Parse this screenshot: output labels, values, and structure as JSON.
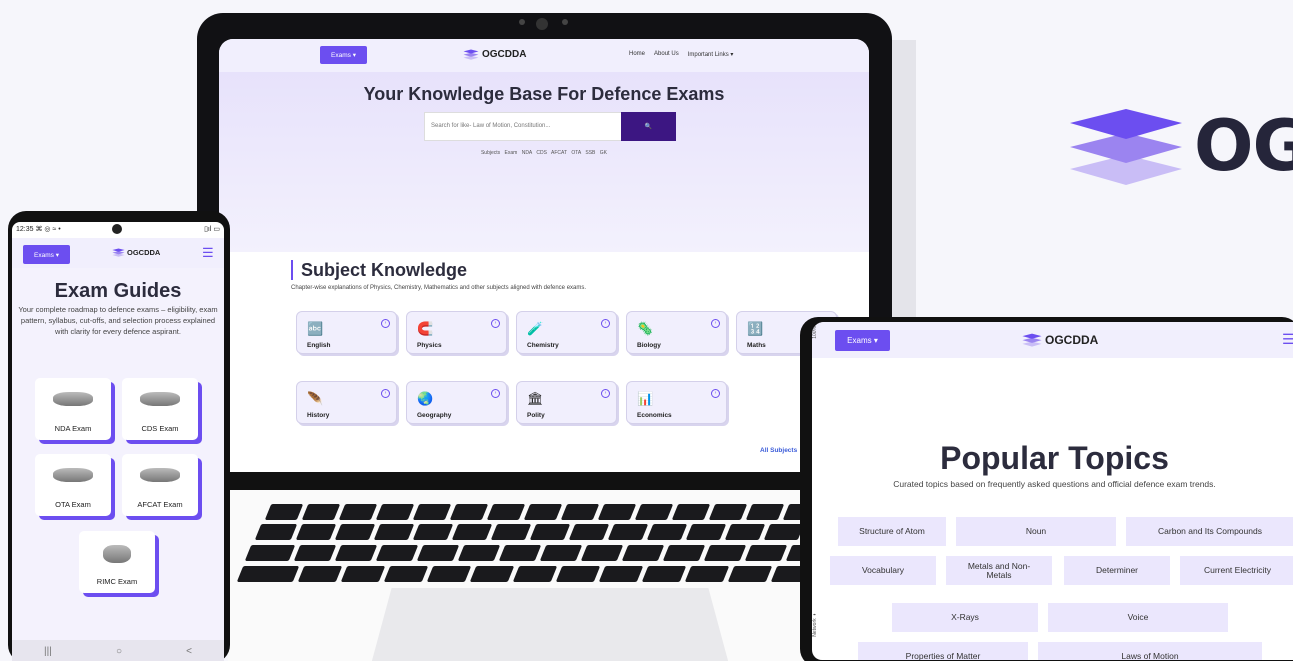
{
  "brand": {
    "logo_text": "OGCDDA",
    "big_logo_text": "OG"
  },
  "laptop": {
    "nav": {
      "exams_label": "Exams ▾",
      "logo": "OGCDDA",
      "links": [
        "Home",
        "About Us",
        "Important Links ▾"
      ]
    },
    "hero": {
      "title": "Your Knowledge Base For Defence Exams",
      "search_placeholder": "Search for like-  Law of Motion, Constitution...",
      "search_button": "🔍",
      "tags": "Subjects  Exam  NDA  CDS  AFCAT  OTA  SSB  GK"
    },
    "subjects": {
      "title": "Subject Knowledge",
      "description": "Chapter-wise explanations of Physics, Chemistry, Mathematics and other subjects aligned with defence exams.",
      "items": [
        {
          "name": "English",
          "icon": "🔤"
        },
        {
          "name": "Physics",
          "icon": "🧲"
        },
        {
          "name": "Chemistry",
          "icon": "🧪"
        },
        {
          "name": "Biology",
          "icon": "🦠"
        },
        {
          "name": "Maths",
          "icon": "🔢"
        },
        {
          "name": "History",
          "icon": "🪶"
        },
        {
          "name": "Geography",
          "icon": "🌏"
        },
        {
          "name": "Polity",
          "icon": "🏛"
        },
        {
          "name": "Economics",
          "icon": "📊"
        }
      ],
      "all_link": "All Subjects"
    }
  },
  "phone": {
    "status": {
      "time": "12:35 ⌘ ◎ ≈ •",
      "right": "▯ıl ▭"
    },
    "nav": {
      "exams_label": "Exams ▾",
      "logo": "OGCDDA",
      "menu": "☰"
    },
    "title": "Exam Guides",
    "description": "Your complete roadmap to defence exams – eligibility, exam pattern, syllabus, cut-offs, and selection process explained with clarity for every defence aspirant.",
    "exams": [
      "NDA Exam",
      "CDS Exam",
      "OTA Exam",
      "AFCAT Exam",
      "RIMC Exam"
    ],
    "bottom": [
      "|||",
      "○",
      "<"
    ]
  },
  "tablet": {
    "nav": {
      "exams_label": "Exams ▾",
      "logo": "OGCDDA",
      "menu": "☰"
    },
    "side_top": "100%",
    "side_bottom": "Network ⌖",
    "title": "Popular Topics",
    "description": "Curated topics based on frequently asked questions and official defence exam trends.",
    "topics": [
      "Structure of Atom",
      "Noun",
      "Carbon and Its Compounds",
      "Vocabulary",
      "Metals and Non-Metals",
      "Determiner",
      "Current Electricity",
      "X-Rays",
      "Voice",
      "Properties of Matter",
      "Laws of Motion"
    ]
  },
  "colors": {
    "accent": "#6c4ef0",
    "dark_button": "#3c1682",
    "light_bg": "#f1effd"
  }
}
